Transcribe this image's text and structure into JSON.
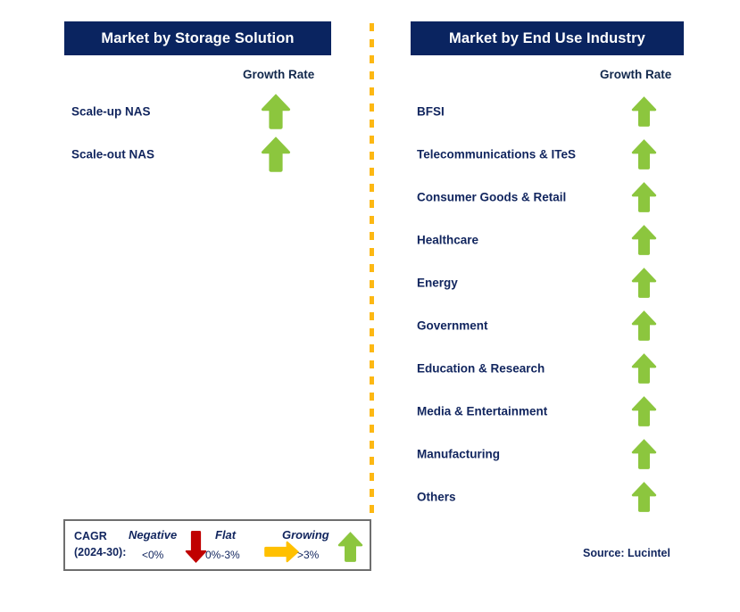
{
  "divider": {
    "color": "#FDB813",
    "style": "dashed-vertical"
  },
  "colors": {
    "header_bg": "#0A2460",
    "text_navy": "#11255E",
    "growth_green": "#8CC63E",
    "negative_red": "#C00000",
    "flat_yellow": "#FFC000",
    "legend_border": "#6E6E6E"
  },
  "panels": [
    {
      "id": "storage",
      "title": "Market by Storage Solution",
      "growth_rate_label": "Growth Rate",
      "rows": [
        {
          "label": "Scale-up NAS",
          "growth": "growing",
          "icon": "arrow-up-icon"
        },
        {
          "label": "Scale-out NAS",
          "growth": "growing",
          "icon": "arrow-up-icon"
        }
      ]
    },
    {
      "id": "enduse",
      "title": "Market by End Use Industry",
      "growth_rate_label": "Growth Rate",
      "rows": [
        {
          "label": "BFSI",
          "growth": "growing",
          "icon": "arrow-up-icon"
        },
        {
          "label": "Telecommunications & ITeS",
          "growth": "growing",
          "icon": "arrow-up-icon"
        },
        {
          "label": "Consumer Goods & Retail",
          "growth": "growing",
          "icon": "arrow-up-icon"
        },
        {
          "label": "Healthcare",
          "growth": "growing",
          "icon": "arrow-up-icon"
        },
        {
          "label": "Energy",
          "growth": "growing",
          "icon": "arrow-up-icon"
        },
        {
          "label": "Government",
          "growth": "growing",
          "icon": "arrow-up-icon"
        },
        {
          "label": "Education & Research",
          "growth": "growing",
          "icon": "arrow-up-icon"
        },
        {
          "label": "Media & Entertainment",
          "growth": "growing",
          "icon": "arrow-up-icon"
        },
        {
          "label": "Manufacturing",
          "growth": "growing",
          "icon": "arrow-up-icon"
        },
        {
          "label": "Others",
          "growth": "growing",
          "icon": "arrow-up-icon"
        }
      ]
    }
  ],
  "legend": {
    "cagr_line1": "CAGR",
    "cagr_line2": "(2024-30):",
    "items": [
      {
        "term": "Negative",
        "range": "<0%",
        "icon": "arrow-down-icon",
        "color": "#C00000"
      },
      {
        "term": "Flat",
        "range": "0%-3%",
        "icon": "arrow-right-icon",
        "color": "#FFC000"
      },
      {
        "term": "Growing",
        "range": ">3%",
        "icon": "arrow-up-icon",
        "color": "#8CC63E"
      }
    ]
  },
  "source": "Source: Lucintel"
}
